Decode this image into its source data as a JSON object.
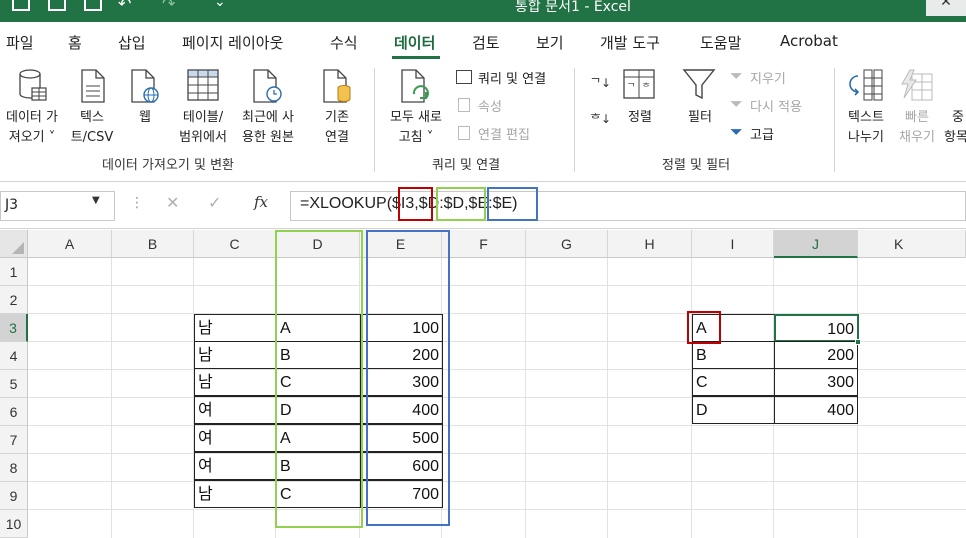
{
  "window": {
    "title": "통합 문서1  -  Excel",
    "close_glyph": "✕"
  },
  "menu": {
    "tabs": [
      {
        "label": "파일"
      },
      {
        "label": "홈"
      },
      {
        "label": "삽입"
      },
      {
        "label": "페이지 레이아웃"
      },
      {
        "label": "수식"
      },
      {
        "label": "데이터"
      },
      {
        "label": "검토"
      },
      {
        "label": "보기"
      },
      {
        "label": "개발 도구"
      },
      {
        "label": "도움말"
      },
      {
        "label": "Acrobat"
      }
    ],
    "active": "데이터"
  },
  "ribbon": {
    "get_data": {
      "line1": "데이터 가",
      "line2": "져오기 ˅"
    },
    "text_csv": {
      "line1": "텍스",
      "line2": "트/CSV"
    },
    "web": {
      "line1": "웹"
    },
    "table_range": {
      "line1": "테이블/",
      "line2": "범위에서"
    },
    "recent_sources": {
      "line1": "최근에 사",
      "line2": "용한 원본"
    },
    "existing_conn": {
      "line1": "기존",
      "line2": "연결"
    },
    "group_get_transform": "데이터 가져오기 및 변환",
    "refresh_all": {
      "line1": "모두 새로",
      "line2": "고침 ˅"
    },
    "queries_connections": "쿼리 및 연결",
    "properties": "속성",
    "edit_links": "연결 편집",
    "group_queries": "쿼리 및 연결",
    "sort_label": "정렬",
    "filter_label": "필터",
    "clear": "지우기",
    "reapply": "다시 적용",
    "advanced": "고급",
    "group_sort_filter": "정렬 및 필터",
    "text_to_columns": {
      "line1": "텍스트",
      "line2": "나누기"
    },
    "flash_fill": {
      "line1": "빠른",
      "line2": "채우기"
    },
    "remove_dup": {
      "line1": "중",
      "line2": "항목"
    }
  },
  "formula_bar": {
    "name_box": "J3",
    "formula_prefix": "=XLOOKUP(",
    "arg1": "$I3",
    "sep1": ",",
    "arg2": "$D:$D",
    "sep2": ",",
    "arg3": "$E:$E",
    "formula_suffix": ")",
    "cancel_glyph": "✕",
    "enter_glyph": "✓",
    "fx_label": "fx",
    "highlight_colors": {
      "arg1": "#c00000",
      "arg2": "#92d050",
      "arg3": "#4472c4"
    }
  },
  "grid": {
    "columns": [
      "A",
      "B",
      "C",
      "D",
      "E",
      "F",
      "G",
      "H",
      "I",
      "J",
      "K"
    ],
    "rows": [
      "1",
      "2",
      "3",
      "4",
      "5",
      "6",
      "7",
      "8",
      "9",
      "10"
    ],
    "selected_cell": "J3",
    "table1": [
      {
        "c": "남",
        "d": "A",
        "e": "100"
      },
      {
        "c": "남",
        "d": "B",
        "e": "200"
      },
      {
        "c": "남",
        "d": "C",
        "e": "300"
      },
      {
        "c": "여",
        "d": "D",
        "e": "400"
      },
      {
        "c": "여",
        "d": "A",
        "e": "500"
      },
      {
        "c": "여",
        "d": "B",
        "e": "600"
      },
      {
        "c": "남",
        "d": "C",
        "e": "700"
      }
    ],
    "table2": [
      {
        "i": "A",
        "j": "100"
      },
      {
        "i": "B",
        "j": "200"
      },
      {
        "i": "C",
        "j": "300"
      },
      {
        "i": "D",
        "j": "400"
      }
    ]
  }
}
